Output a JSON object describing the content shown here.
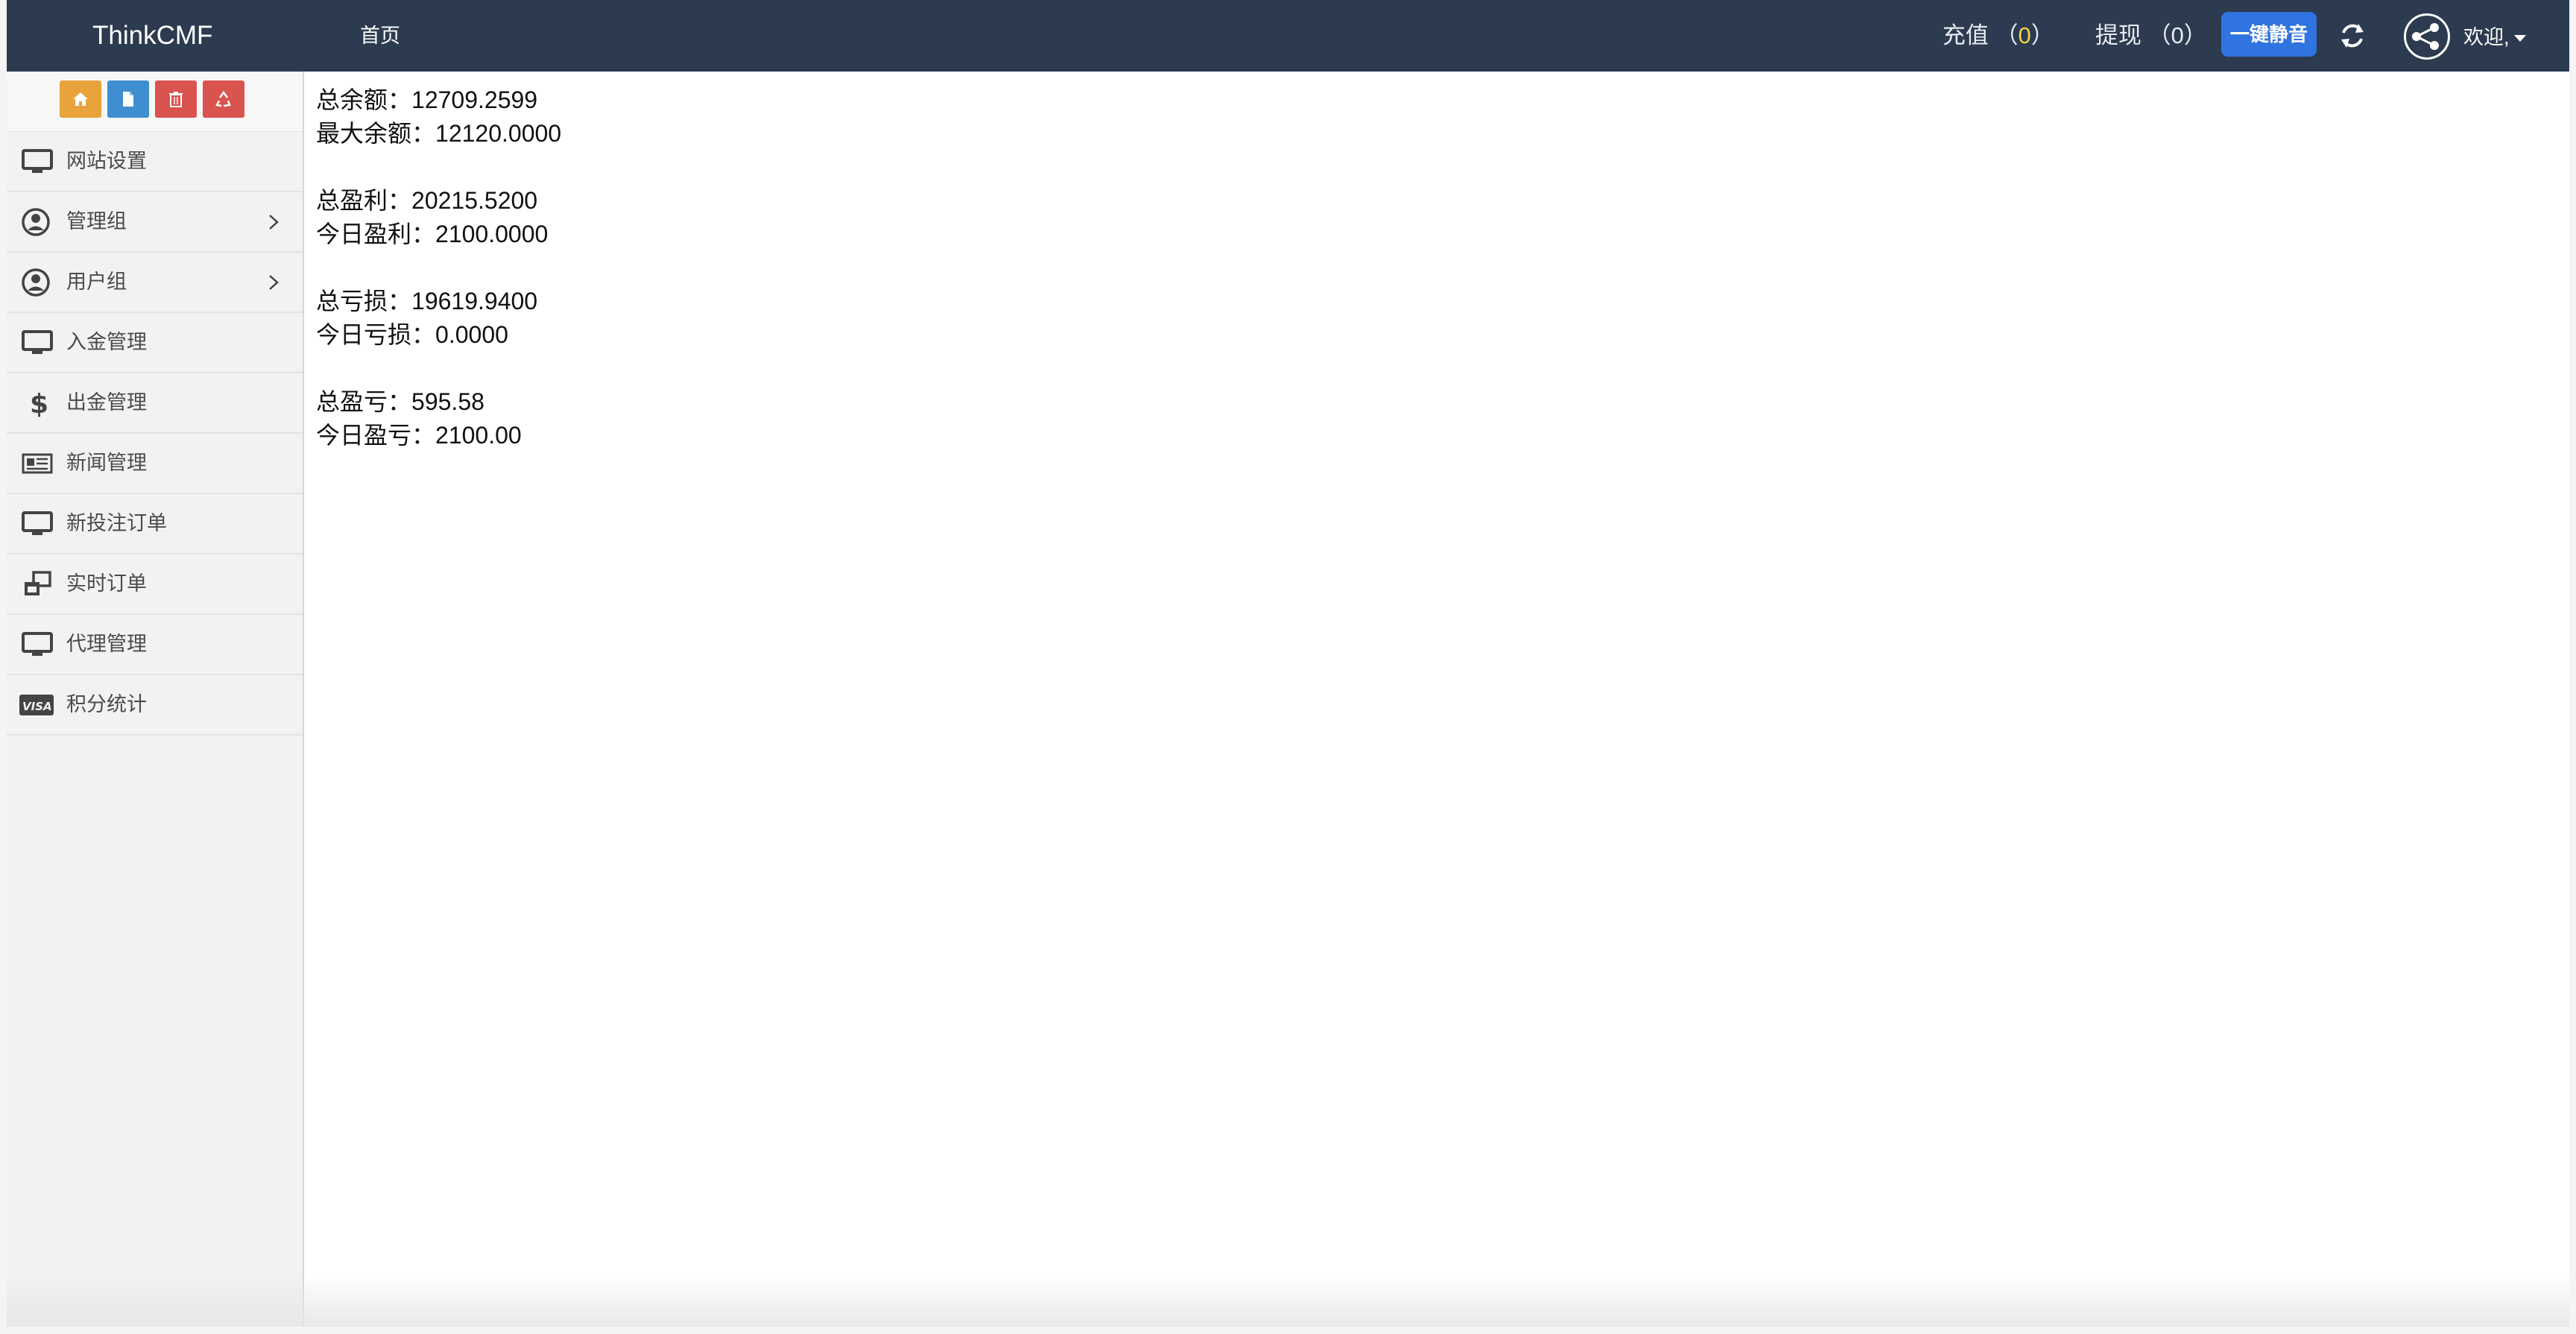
{
  "navbar": {
    "brand": "ThinkCMF",
    "home": "首页",
    "recharge_label": "充值",
    "recharge_count": "0",
    "withdraw_label": "提现",
    "withdraw_count": "0",
    "mute_button": "一键静音",
    "welcome": "欢迎,"
  },
  "shortcuts": [
    {
      "icon": "home-icon",
      "color": "#e8a33a"
    },
    {
      "icon": "file-icon",
      "color": "#3e8ed0"
    },
    {
      "icon": "trash-icon",
      "color": "#d9534f"
    },
    {
      "icon": "recycle-icon",
      "color": "#d9534f"
    }
  ],
  "sidebar": {
    "items": [
      {
        "label": "网站设置",
        "icon": "monitor-icon"
      },
      {
        "label": "管理组",
        "icon": "user-circle-icon",
        "has_children": true
      },
      {
        "label": "用户组",
        "icon": "user-circle-icon",
        "has_children": true
      },
      {
        "label": "入金管理",
        "icon": "monitor-icon"
      },
      {
        "label": "出金管理",
        "icon": "dollar-icon"
      },
      {
        "label": "新闻管理",
        "icon": "newspaper-icon"
      },
      {
        "label": "新投注订单",
        "icon": "monitor-icon"
      },
      {
        "label": "实时订单",
        "icon": "windows-icon"
      },
      {
        "label": "代理管理",
        "icon": "monitor-icon"
      },
      {
        "label": "积分统计",
        "icon": "visa-icon"
      }
    ]
  },
  "stats": [
    {
      "label": "总余额",
      "value": "12709.2599"
    },
    {
      "label": "最大余额",
      "value": "12120.0000"
    },
    {
      "label": "总盈利",
      "value": "20215.5200"
    },
    {
      "label": "今日盈利",
      "value": "2100.0000"
    },
    {
      "label": "总亏损",
      "value": "19619.9400"
    },
    {
      "label": "今日亏损",
      "value": "0.0000"
    },
    {
      "label": "总盈亏",
      "value": "595.58"
    },
    {
      "label": "今日盈亏",
      "value": "2100.00"
    }
  ],
  "colors": {
    "navbar": "#2c3b4f",
    "accent": "#2f74e0",
    "count_highlight": "#f1d34a"
  }
}
